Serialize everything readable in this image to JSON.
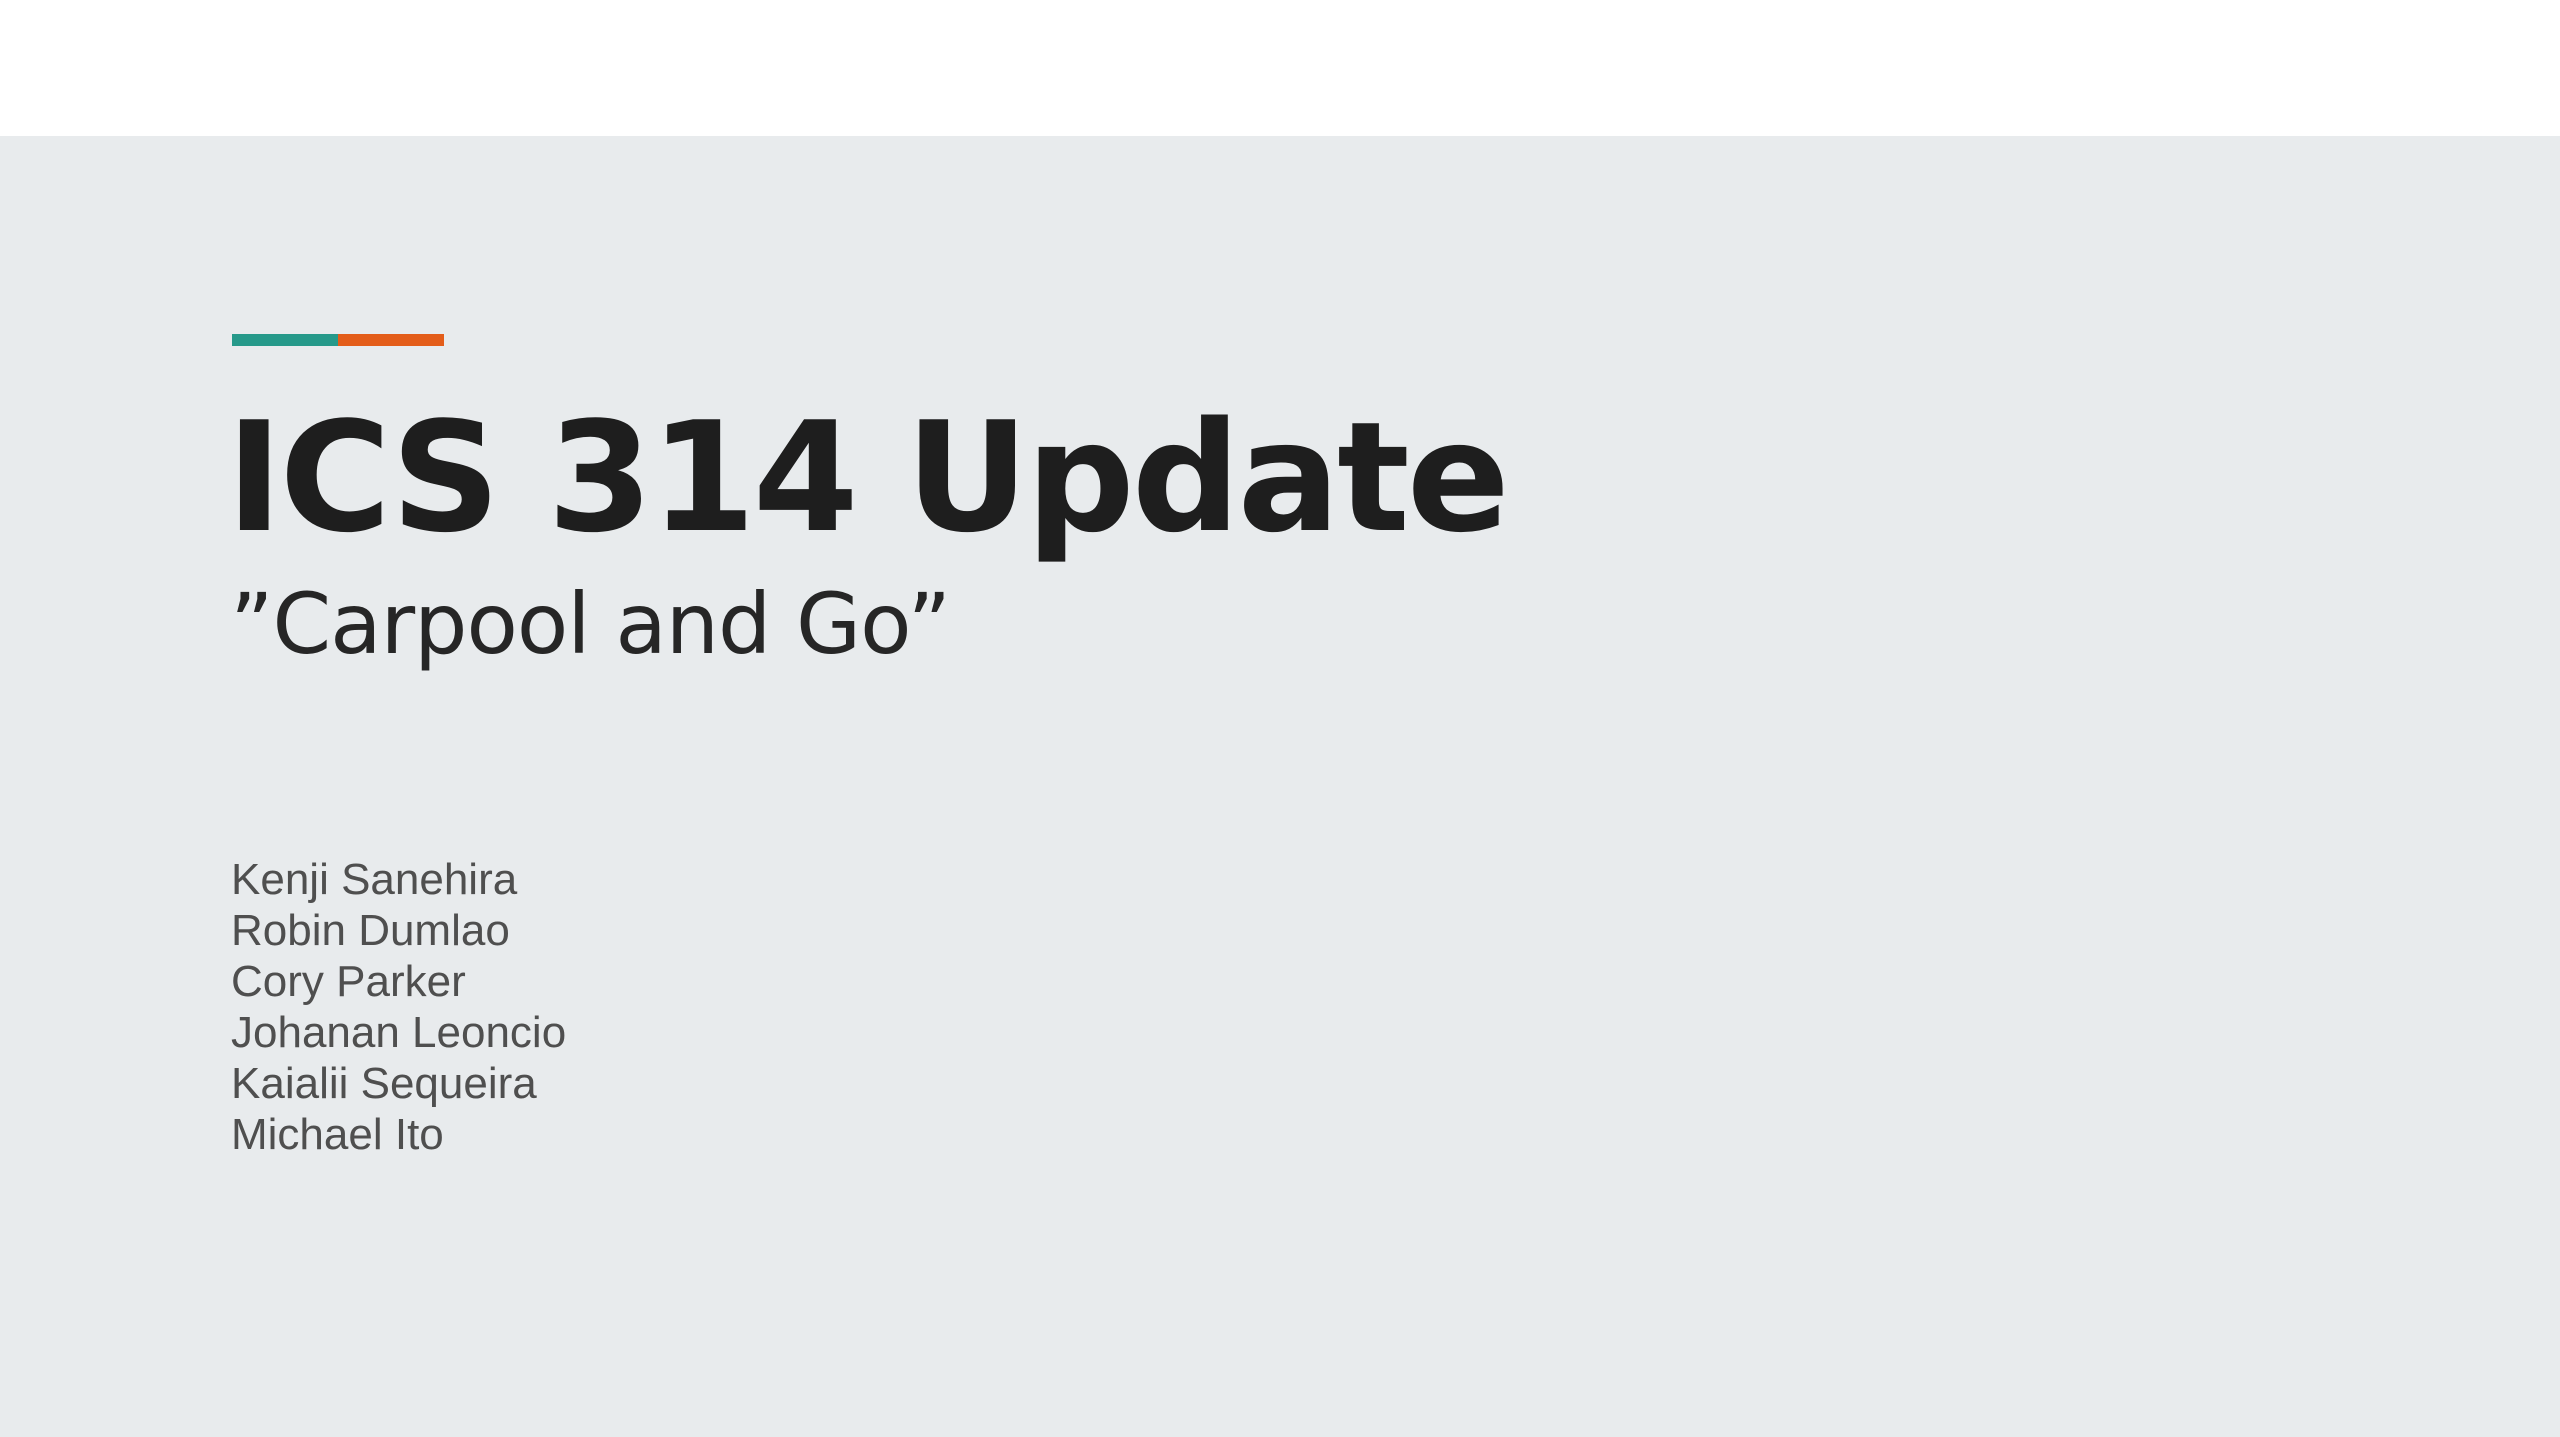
{
  "slide": {
    "background": "#e8ebed",
    "accent_colors": [
      "#26998a",
      "#e35d1a"
    ],
    "title": "ICS 314 Update",
    "subtitle": "”Carpool and Go”",
    "members": [
      "Kenji Sanehira",
      "Robin Dumlao",
      "Cory Parker",
      "Johanan Leoncio",
      "Kaialii Sequeira",
      "Michael Ito"
    ]
  }
}
